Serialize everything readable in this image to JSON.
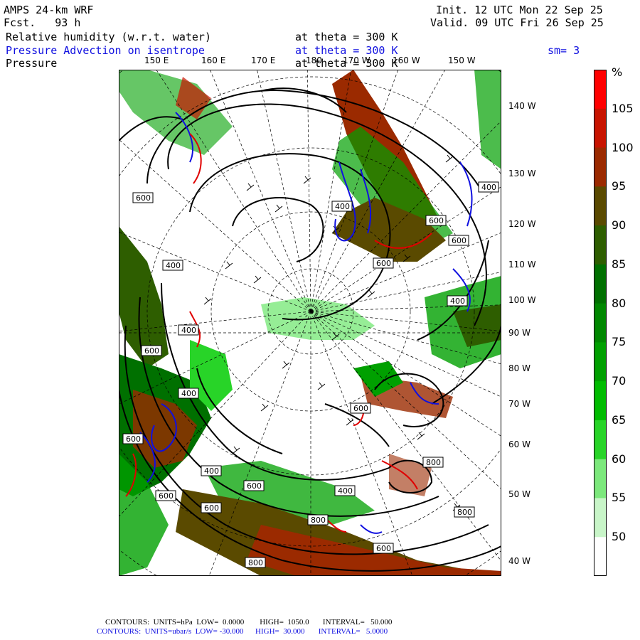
{
  "header": {
    "model": "AMPS 24-km WRF",
    "fcst": "Fcst.   93 h",
    "init": "Init. 12 UTC Mon 22 Sep 25",
    "valid": "Valid. 09 UTC Fri 26 Sep 25",
    "field1_name": "Relative humidity (w.r.t. water)",
    "field1_level": "at theta = 300 K",
    "field2_name": "Pressure Advection on isentrope",
    "field2_level": "at theta = 300 K",
    "field2_smooth": "sm= 3",
    "field3_name": "Pressure",
    "field3_level": "at theta = 300 K"
  },
  "top_longitudes": [
    "150 E",
    "160 E",
    "170 E",
    "180",
    "170 W",
    "160 W",
    "150 W"
  ],
  "right_longitudes": [
    "140 W",
    "130 W",
    "120 W",
    "110 W",
    "100 W",
    "90 W",
    "80 W",
    "70 W",
    "60 W",
    "50 W",
    "40 W"
  ],
  "contour_labels": [
    "600",
    "400",
    "400",
    "600",
    "400",
    "600",
    "600",
    "400",
    "400",
    "600",
    "600",
    "800",
    "600",
    "600",
    "400",
    "400",
    "800",
    "600",
    "800",
    "600",
    "600",
    "800",
    "400"
  ],
  "colorbar": {
    "unit": "%",
    "labels": [
      "105",
      "100",
      "95",
      "90",
      "85",
      "80",
      "75",
      "70",
      "65",
      "60",
      "55",
      "50"
    ],
    "colors": [
      "#ff0000",
      "#c81400",
      "#9b2a00",
      "#5a4a00",
      "#2e5e00",
      "#007000",
      "#008800",
      "#00a000",
      "#00bc00",
      "#28d428",
      "#7ce87c",
      "#c8f5c8",
      "#ffffff"
    ]
  },
  "footer": {
    "line1": "CONTOURS:  UNITS=hPa  LOW=  0.0000        HIGH=  1050.0       INTERVAL=   50.000",
    "line2": "CONTOURS:  UNITS=ubar/s  LOW= -30.000      HIGH=  30.000       INTERVAL=   5.0000"
  },
  "colors": {
    "advection": "#1010e0",
    "negative_advection": "#e00000",
    "pressure": "#000000"
  }
}
